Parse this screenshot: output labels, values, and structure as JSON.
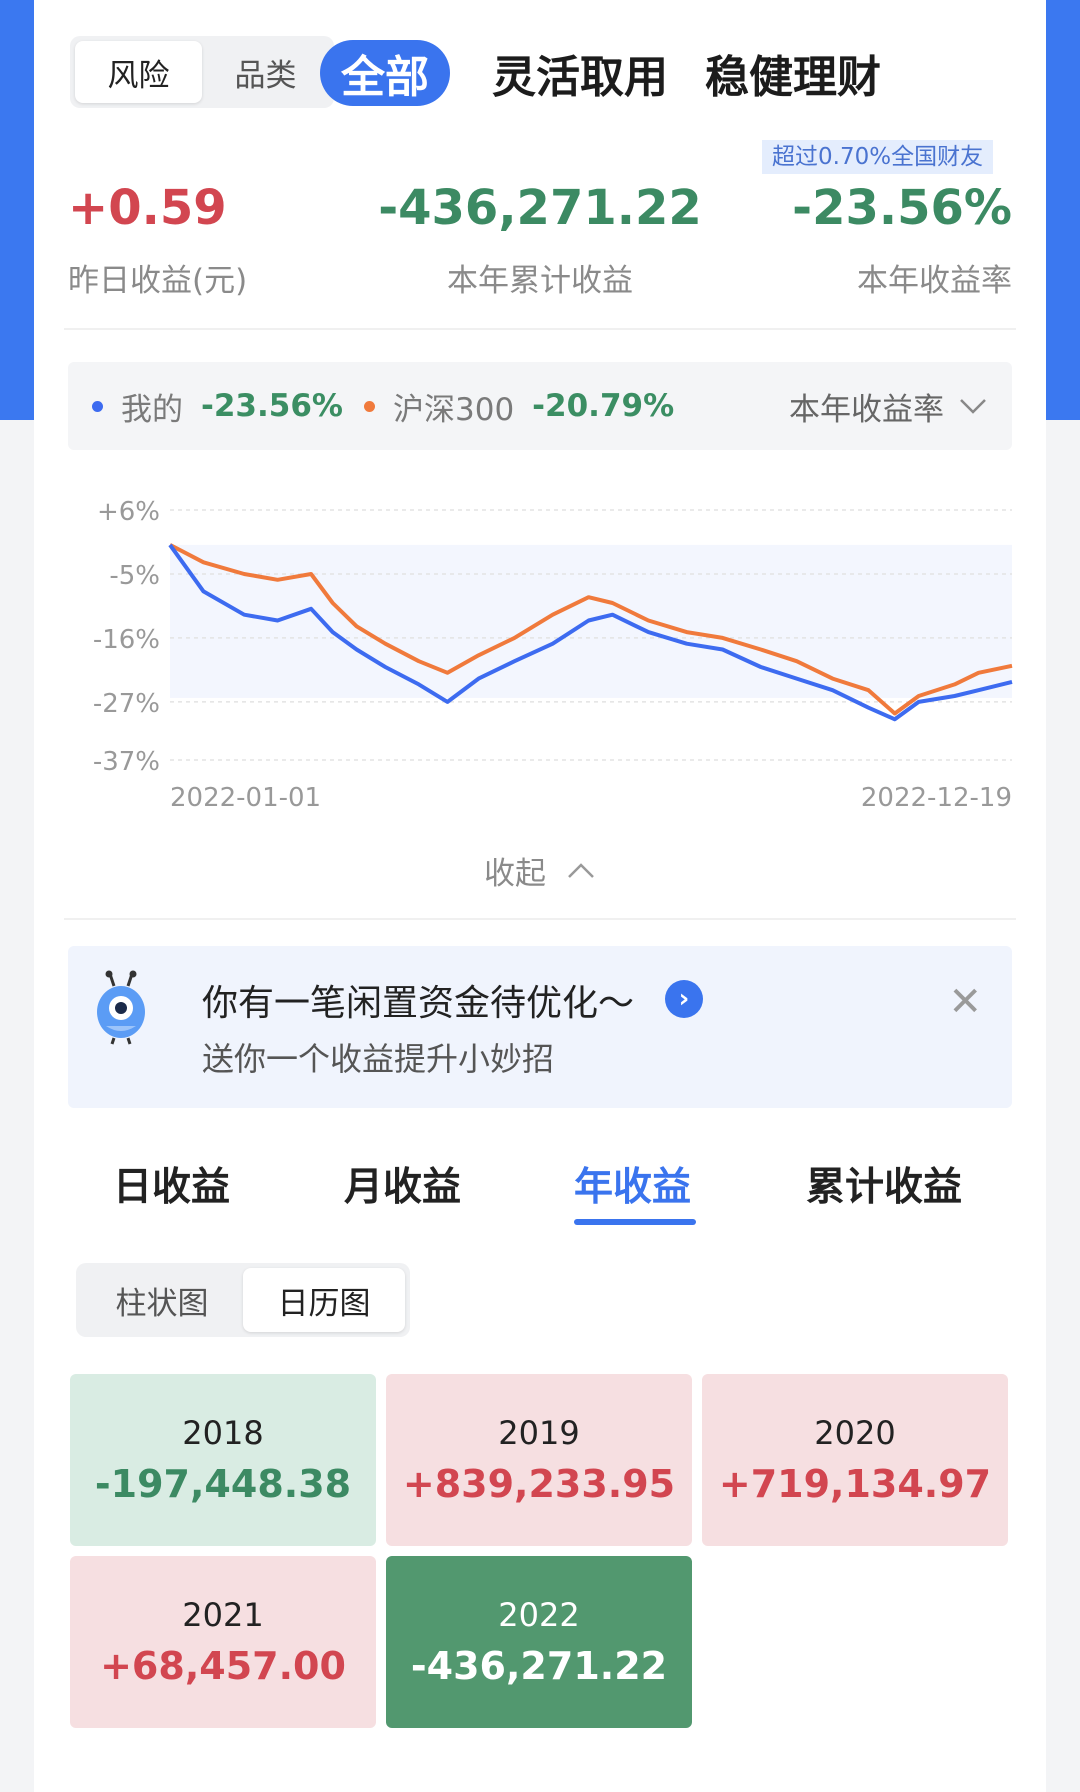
{
  "segment_top": {
    "items": [
      "风险",
      "品类"
    ],
    "active": 0
  },
  "top_tabs": [
    "全部",
    "灵活取用",
    "稳健理财"
  ],
  "badge": "超过0.70%全国财友",
  "kpis": [
    {
      "value": "+0.59",
      "label": "昨日收益(元)",
      "color": "#d24650"
    },
    {
      "value": "-436,271.22",
      "label": "本年累计收益",
      "color": "#3c8a63"
    },
    {
      "value": "-23.56%",
      "label": "本年收益率",
      "color": "#3c8a63"
    }
  ],
  "legend": {
    "mine_label": "我的",
    "mine_value": "-23.56%",
    "bench_label": "沪深300",
    "bench_value": "-20.79%",
    "select": "本年收益率"
  },
  "colors": {
    "mine": "#3d6bf0",
    "bench": "#f07a3c",
    "accent": "#3a74ee"
  },
  "chart_data": {
    "type": "line",
    "y_ticks": [
      "+6%",
      "-5%",
      "-16%",
      "-27%",
      "-37%"
    ],
    "x_ticks": [
      "2022-01-01",
      "2022-12-19"
    ],
    "ylim": [
      -37,
      6
    ],
    "xlim": [
      "2022-01-01",
      "2022-12-19"
    ],
    "series": [
      {
        "name": "我的",
        "x": [
          "2022-01-01",
          "2022-01-15",
          "2022-02-01",
          "2022-02-15",
          "2022-03-01",
          "2022-03-10",
          "2022-03-20",
          "2022-04-01",
          "2022-04-15",
          "2022-04-27",
          "2022-05-10",
          "2022-05-25",
          "2022-06-10",
          "2022-06-25",
          "2022-07-05",
          "2022-07-20",
          "2022-08-05",
          "2022-08-20",
          "2022-09-05",
          "2022-09-20",
          "2022-10-05",
          "2022-10-20",
          "2022-10-31",
          "2022-11-10",
          "2022-11-25",
          "2022-12-05",
          "2022-12-19"
        ],
        "values": [
          0,
          -8,
          -12,
          -13,
          -11,
          -15,
          -18,
          -21,
          -24,
          -27,
          -23,
          -20,
          -17,
          -13,
          -12,
          -15,
          -17,
          -18,
          -21,
          -23,
          -25,
          -28,
          -30,
          -27,
          -26,
          -25,
          -23.56
        ]
      },
      {
        "name": "沪深300",
        "x": [
          "2022-01-01",
          "2022-01-15",
          "2022-02-01",
          "2022-02-15",
          "2022-03-01",
          "2022-03-10",
          "2022-03-20",
          "2022-04-01",
          "2022-04-15",
          "2022-04-27",
          "2022-05-10",
          "2022-05-25",
          "2022-06-10",
          "2022-06-25",
          "2022-07-05",
          "2022-07-20",
          "2022-08-05",
          "2022-08-20",
          "2022-09-05",
          "2022-09-20",
          "2022-10-05",
          "2022-10-20",
          "2022-10-31",
          "2022-11-10",
          "2022-11-25",
          "2022-12-05",
          "2022-12-19"
        ],
        "values": [
          0,
          -3,
          -5,
          -6,
          -5,
          -10,
          -14,
          -17,
          -20,
          -22,
          -19,
          -16,
          -12,
          -9,
          -10,
          -13,
          -15,
          -16,
          -18,
          -20,
          -23,
          -25,
          -29,
          -26,
          -24,
          -22,
          -20.79
        ]
      }
    ]
  },
  "collapse_label": "收起",
  "promo": {
    "title": "你有一笔闲置资金待优化～",
    "subtitle": "送你一个收益提升小妙招"
  },
  "period_tabs": [
    "日收益",
    "月收益",
    "年收益",
    "累计收益"
  ],
  "period_active": 2,
  "view_toggle": {
    "items": [
      "柱状图",
      "日历图"
    ],
    "active": 1
  },
  "years": [
    {
      "year": "2018",
      "amount": "-197,448.38",
      "style": "neg"
    },
    {
      "year": "2019",
      "amount": "+839,233.95",
      "style": "pos"
    },
    {
      "year": "2020",
      "amount": "+719,134.97",
      "style": "pos"
    },
    {
      "year": "2021",
      "amount": "+68,457.00",
      "style": "pos"
    },
    {
      "year": "2022",
      "amount": "-436,271.22",
      "style": "neg-strong"
    }
  ]
}
